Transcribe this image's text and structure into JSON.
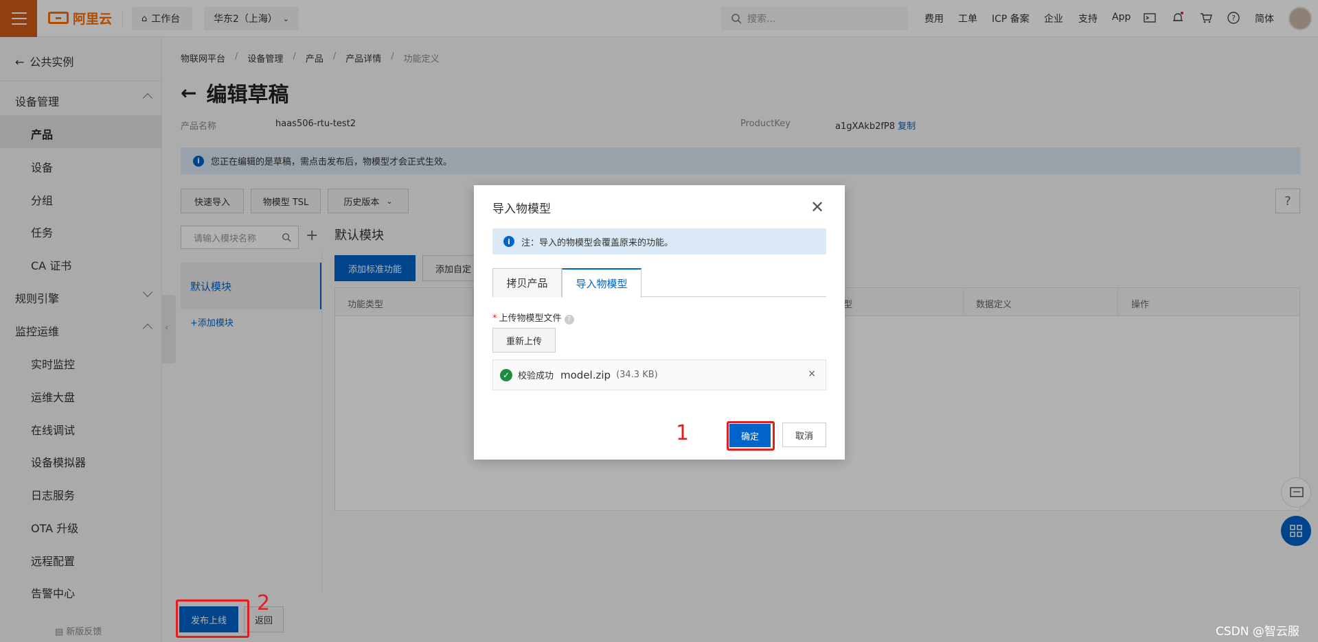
{
  "topbar": {
    "logo_text": "阿里云",
    "workbench": "工作台",
    "region": "华东2（上海）",
    "search_placeholder": "搜索...",
    "nav": [
      "费用",
      "工单",
      "ICP 备案",
      "企业",
      "支持",
      "App"
    ],
    "lang": "简体",
    "brand_color": "#ff6a00"
  },
  "sidebar": {
    "back": "公共实例",
    "group1": "设备管理",
    "items1": [
      "产品",
      "设备",
      "分组",
      "任务",
      "CA 证书"
    ],
    "group2": "规则引擎",
    "group3": "监控运维",
    "items3": [
      "实时监控",
      "运维大盘",
      "在线调试",
      "设备模拟器",
      "日志服务",
      "OTA 升级",
      "远程配置",
      "告警中心"
    ],
    "feedback": "新版反馈"
  },
  "breadcrumb": [
    "物联网平台",
    "设备管理",
    "产品",
    "产品详情",
    "功能定义"
  ],
  "page": {
    "title": "编辑草稿",
    "product_name_label": "产品名称",
    "product_name": "haas506-rtu-test2",
    "productkey_label": "ProductKey",
    "productkey": "a1gXAkb2fP8",
    "copy": "复制",
    "notice": "您正在编辑的是草稿，需点击发布后，物模型才会正式生效。",
    "toolbar": [
      "快速导入",
      "物模型 TSL",
      "历史版本"
    ],
    "help": "?"
  },
  "modules": {
    "search_placeholder": "请输入模块名称",
    "plus": "+",
    "items": [
      "默认模块"
    ],
    "add": "+添加模块",
    "title": "默认模块",
    "add_std": "添加标准功能",
    "add_custom": "添加自定"
  },
  "table": {
    "headers": [
      "功能类型",
      "型",
      "数据定义",
      "操作"
    ]
  },
  "footer": {
    "publish": "发布上线",
    "back": "返回"
  },
  "modal": {
    "title": "导入物模型",
    "notice": "注：导入的物模型会覆盖原来的功能。",
    "tabs": [
      "拷贝产品",
      "导入物模型"
    ],
    "active_tab": "导入物模型",
    "upload_label": "上传物模型文件",
    "reupload": "重新上传",
    "file_status": "校验成功",
    "file_name": "model.zip",
    "file_size": "(34.3 KB)",
    "confirm": "确定",
    "cancel": "取消",
    "accent": "#0064c8"
  },
  "annotations": {
    "step1": "1",
    "step2": "2",
    "color": "#e02020"
  },
  "watermark": "CSDN @智云服"
}
